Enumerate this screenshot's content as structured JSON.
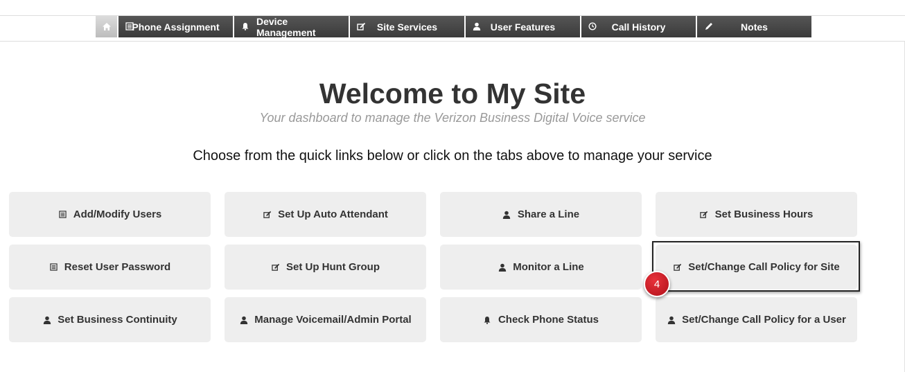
{
  "nav": {
    "tabs": [
      {
        "label": "Phone Assignment",
        "icon": "list-icon"
      },
      {
        "label": "Device Management",
        "icon": "bell-icon"
      },
      {
        "label": "Site Services",
        "icon": "edit-icon"
      },
      {
        "label": "User Features",
        "icon": "user-icon"
      },
      {
        "label": "Call History",
        "icon": "clock-icon"
      },
      {
        "label": "Notes",
        "icon": "pencil-icon"
      }
    ]
  },
  "header": {
    "title": "Welcome to My Site",
    "subtitle": "Your dashboard to manage the Verizon Business Digital Voice service"
  },
  "instructions": "Choose from the quick links below or click on the tabs above to manage your service",
  "quick_links": [
    {
      "label": "Add/Modify Users",
      "icon": "list-icon"
    },
    {
      "label": "Set Up Auto Attendant",
      "icon": "edit-icon"
    },
    {
      "label": "Share a Line",
      "icon": "user-icon"
    },
    {
      "label": "Set Business Hours",
      "icon": "edit-icon"
    },
    {
      "label": "Reset User Password",
      "icon": "list-icon"
    },
    {
      "label": "Set Up Hunt Group",
      "icon": "edit-icon"
    },
    {
      "label": "Monitor a Line",
      "icon": "user-icon"
    },
    {
      "label": "Set/Change Call Policy for Site",
      "icon": "edit-icon"
    },
    {
      "label": "Set Business Continuity",
      "icon": "user-icon"
    },
    {
      "label": "Manage Voicemail/Admin Portal",
      "icon": "user-icon"
    },
    {
      "label": "Check Phone Status",
      "icon": "bell-icon"
    },
    {
      "label": "Set/Change Call Policy for a User",
      "icon": "user-icon"
    }
  ],
  "step_badge": "4",
  "colors": {
    "accent": "#c8161d",
    "tab_bg": "#444444",
    "link_bg": "#eeeeee"
  }
}
